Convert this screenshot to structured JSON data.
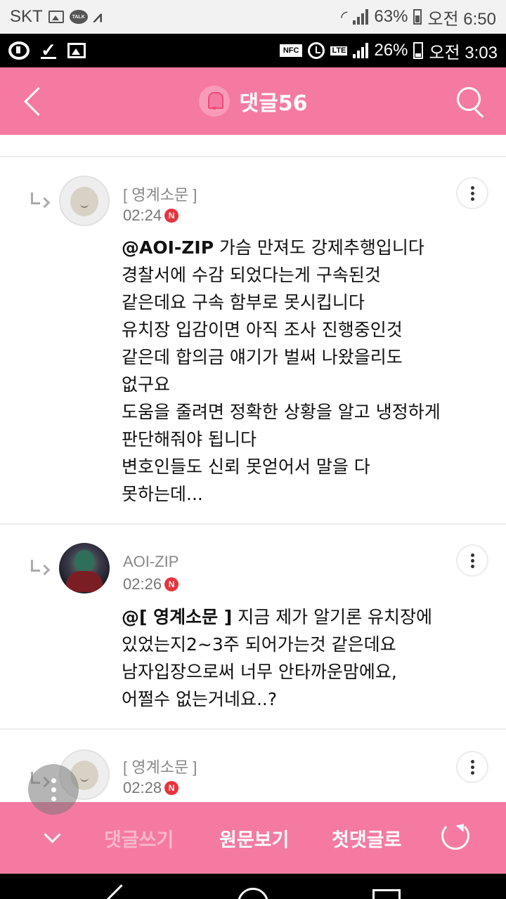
{
  "outer_status": {
    "carrier": "SKT",
    "icons": [
      "gallery-icon",
      "kakaotalk-icon",
      "v-app-icon",
      "wifi-icon",
      "signal-icon",
      "battery-icon"
    ],
    "talk_icon_label": "TALK",
    "battery": "63%",
    "time": "오전 6:50"
  },
  "inner_status": {
    "icons": [
      "u-app-icon",
      "download-check-icon",
      "gallery-icon",
      "nfc-icon",
      "alarm-icon",
      "lte-icon",
      "signal-icon",
      "battery-icon"
    ],
    "nfc_label": "NFC",
    "lte_label": "LTE",
    "battery": "26%",
    "time": "오전 3:03"
  },
  "header": {
    "title": "댓글56",
    "icons": [
      "back-icon",
      "bell-icon",
      "search-icon"
    ]
  },
  "comments": [
    {
      "author": "[ 영계소문 ]",
      "time": "02:24",
      "new_badge": "N",
      "mention": "@AOI-ZIP",
      "body": [
        "가슴 만져도 강제추행입니다",
        "경찰서에 수감 되었다는게 구속된것",
        "같은데요 구속 함부로 못시킵니다",
        "유치장 입감이면 아직 조사 진행중인것",
        "같은데 합의금 얘기가 벌써 나왔을리도",
        "없구요",
        "도움을 줄려면 정확한 상황을 알고 냉정하게",
        "판단해줘야 됩니다",
        "변호인들도 신뢰 못얻어서 말을 다",
        "못하는데..."
      ]
    },
    {
      "author": "AOI-ZIP",
      "time": "02:26",
      "new_badge": "N",
      "mention": "@[ 영계소문 ]",
      "body": [
        "지금 제가 알기론 유치장에",
        "있었는지2~3주 되어가는것 같은데요",
        "남자입장으로써 너무 안타까운맘에요,",
        "어쩔수 없는거네요..?"
      ]
    },
    {
      "author": "[ 영계소문 ]",
      "time": "02:28",
      "new_badge": "N"
    }
  ],
  "bottom_bar": {
    "write": "댓글쓰기",
    "original": "원문보기",
    "first": "첫댓글로",
    "icons": [
      "chevron-down-icon",
      "refresh-icon"
    ]
  },
  "colors": {
    "accent": "#f57aa2",
    "new_badge": "#e8333c"
  }
}
